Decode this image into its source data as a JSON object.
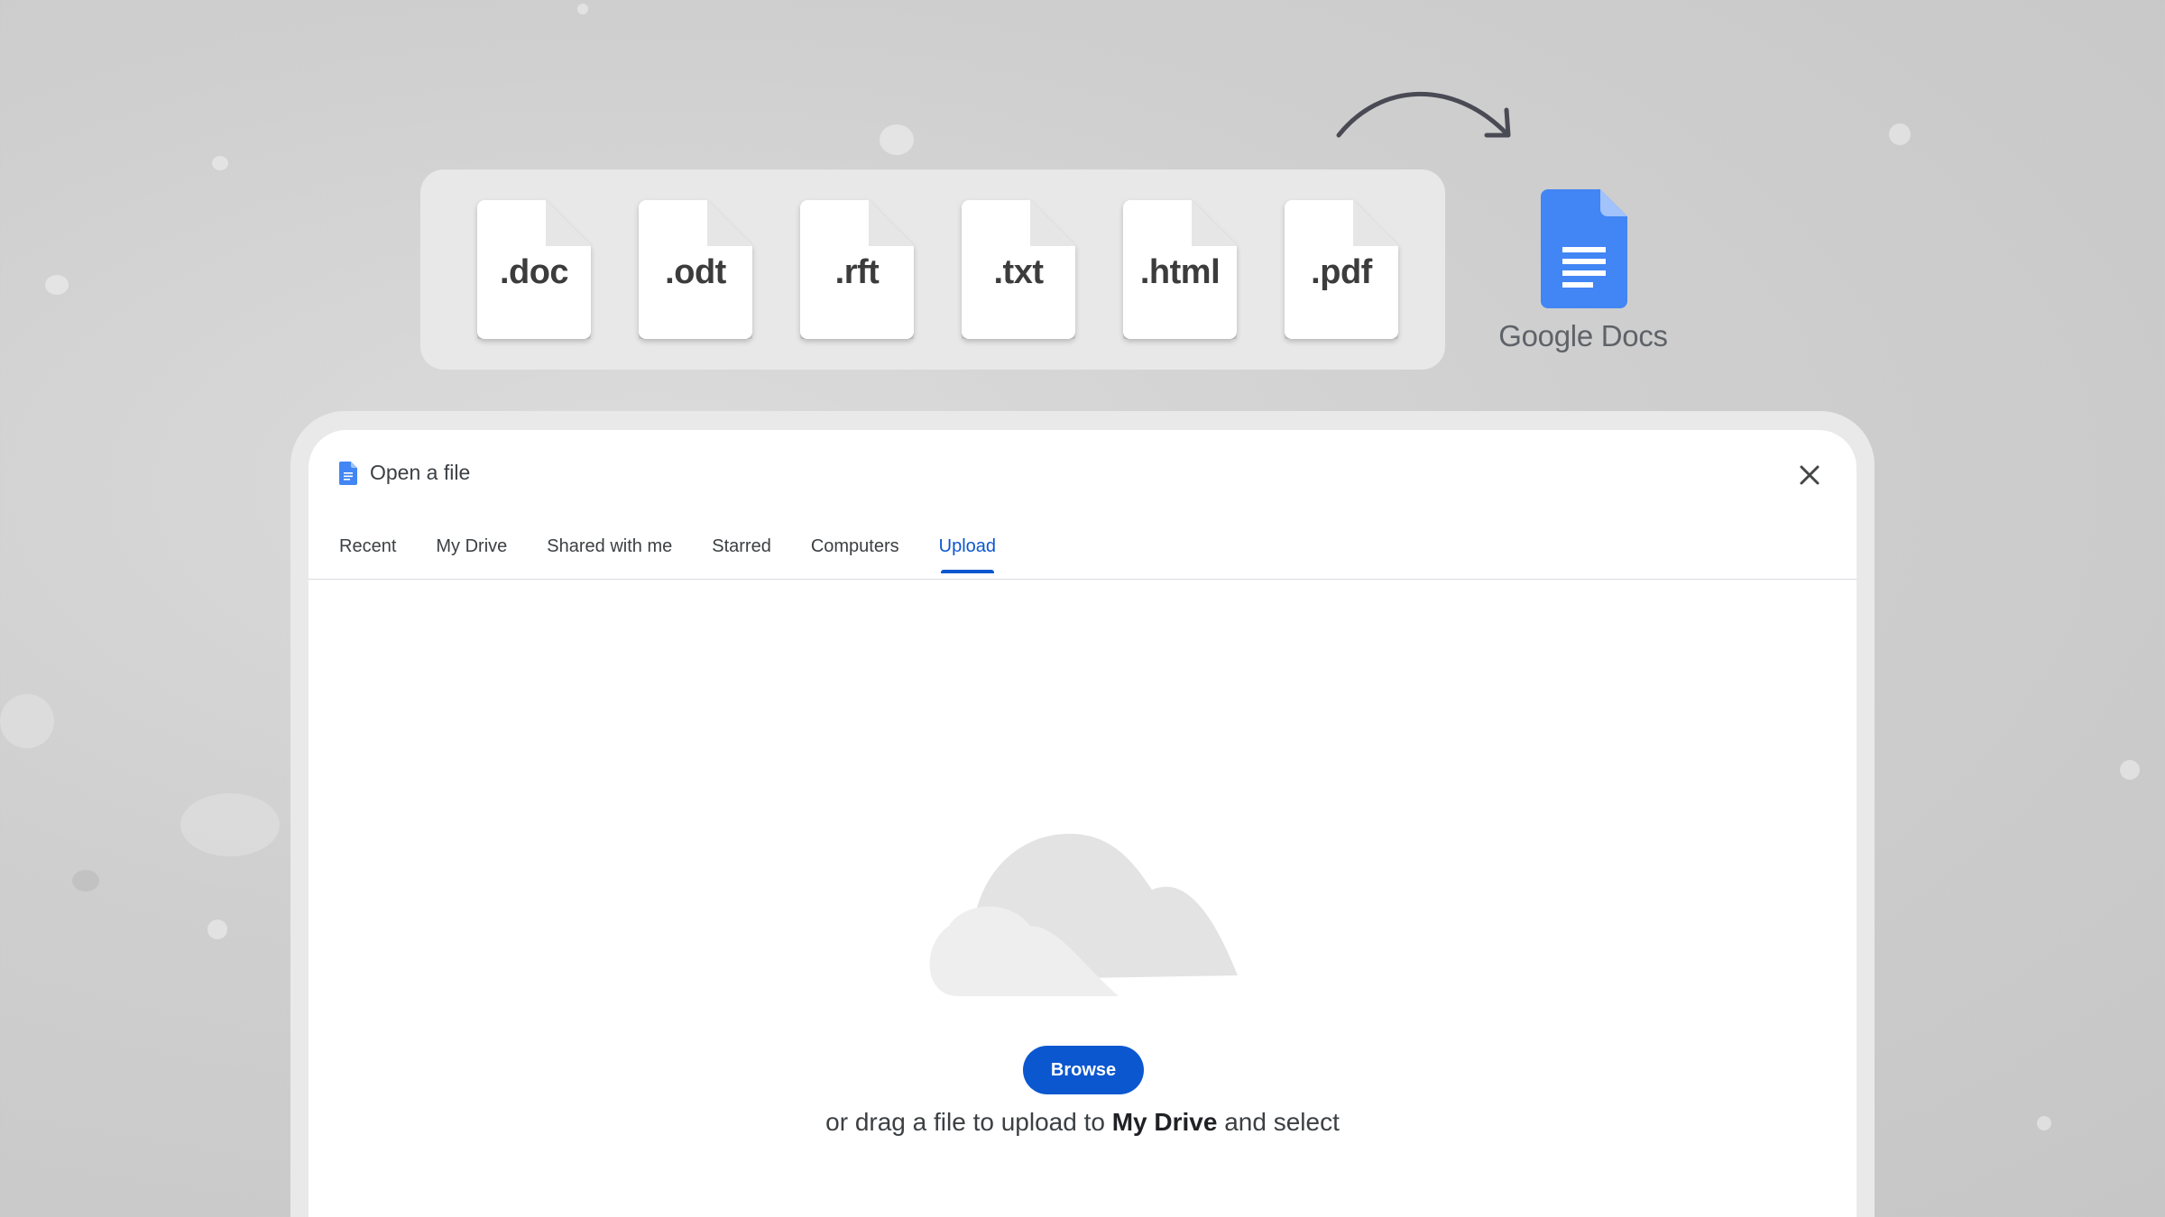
{
  "formats": {
    "files": [
      {
        "ext": ".doc"
      },
      {
        "ext": ".odt"
      },
      {
        "ext": ".rft"
      },
      {
        "ext": ".txt"
      },
      {
        "ext": ".html"
      },
      {
        "ext": ".pdf"
      }
    ]
  },
  "brand": {
    "name": "Google Docs",
    "icon": "google-docs-icon",
    "color": "#4285f4"
  },
  "dialog": {
    "title": "Open a file",
    "tabs": [
      {
        "label": "Recent"
      },
      {
        "label": "My Drive"
      },
      {
        "label": "Shared with me"
      },
      {
        "label": "Starred"
      },
      {
        "label": "Computers"
      },
      {
        "label": "Upload",
        "active": true
      }
    ],
    "browse_label": "Browse",
    "drag_text_prefix": "or drag a file to upload to ",
    "drag_text_target": "My Drive",
    "drag_text_suffix": " and select",
    "accent": "#0b57d0"
  }
}
